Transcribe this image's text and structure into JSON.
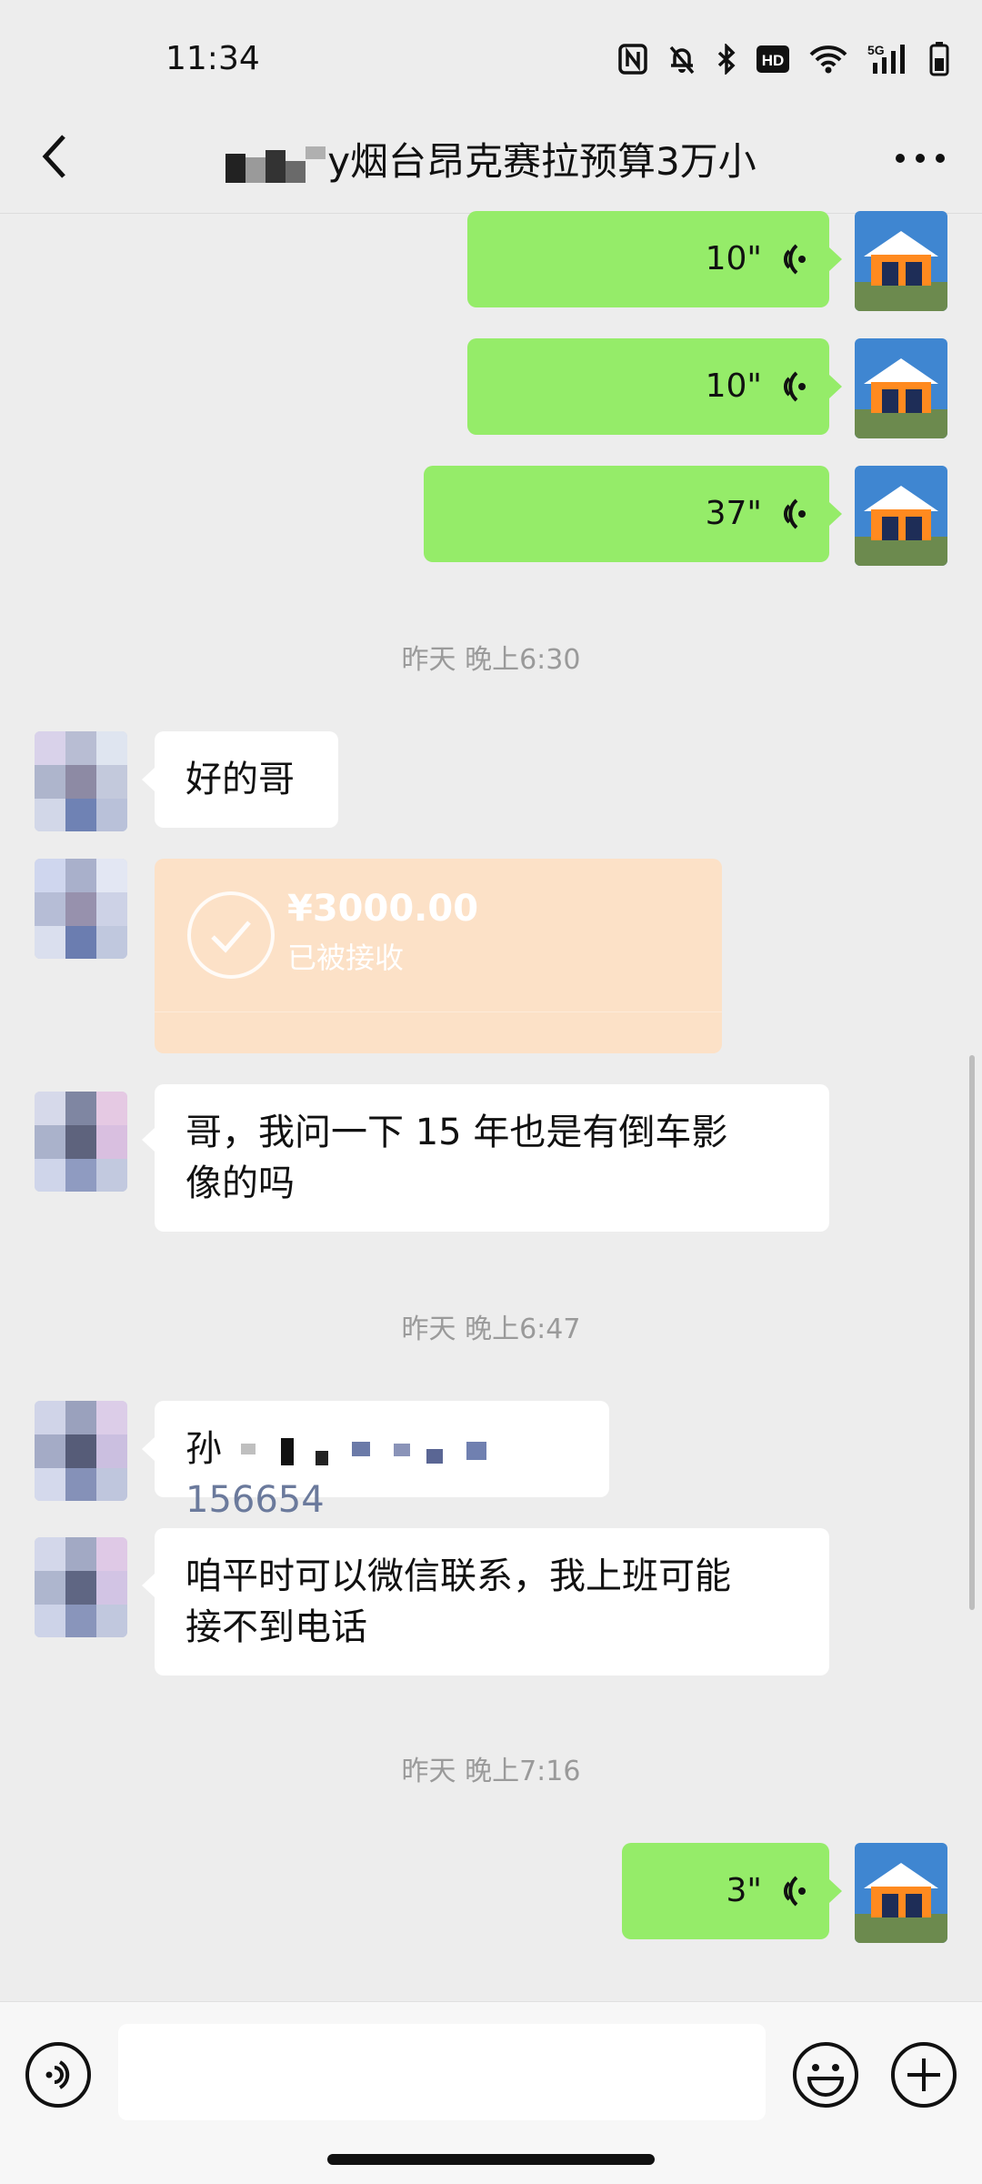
{
  "status_bar": {
    "time": "11:34",
    "icons": [
      "nfc-icon",
      "mute-icon",
      "bluetooth-icon",
      "hd-icon",
      "wifi-icon",
      "5g-signal-icon",
      "battery-icon"
    ],
    "network_label": "5G",
    "hd_label": "HD"
  },
  "header": {
    "title": "y烟台昂克赛拉预算3万小"
  },
  "messages": [
    {
      "side": "me",
      "type": "voice",
      "duration": "10\""
    },
    {
      "side": "me",
      "type": "voice",
      "duration": "10\""
    },
    {
      "side": "me",
      "type": "voice",
      "duration": "37\""
    },
    {
      "type": "timestamp",
      "text": "昨天 晚上6:30"
    },
    {
      "side": "other",
      "type": "text",
      "text": "好的哥"
    },
    {
      "side": "other",
      "type": "transfer",
      "amount": "¥3000.00",
      "status": "已被接收"
    },
    {
      "side": "other",
      "type": "text",
      "lines": [
        "哥，我问一下 15 年也是有倒车影",
        "像的吗"
      ]
    },
    {
      "type": "timestamp",
      "text": "昨天 晚上6:47"
    },
    {
      "side": "other",
      "type": "text",
      "prefix": "孙",
      "suffix": "156654"
    },
    {
      "side": "other",
      "type": "text",
      "lines": [
        "咱平时可以微信联系，我上班可能",
        "接不到电话"
      ]
    },
    {
      "type": "timestamp",
      "text": "昨天 晚上7:16"
    },
    {
      "side": "me",
      "type": "voice",
      "duration": "3\""
    }
  ],
  "input_bar": {
    "icons": [
      "voice-input-icon",
      "emoji-icon",
      "add-icon"
    ]
  },
  "colors": {
    "background": "#ededed",
    "my_bubble": "#95ec69",
    "other_bubble": "#ffffff",
    "transfer_card": "#fce1c7",
    "timestamp_text": "#9a9a9a"
  }
}
